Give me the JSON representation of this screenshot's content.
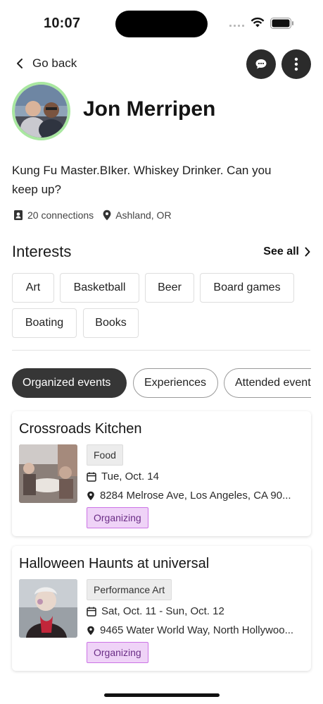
{
  "status_bar": {
    "time": "10:07"
  },
  "header": {
    "back_label": "Go back",
    "chat_icon": "chat-bubble-icon",
    "more_icon": "more-vertical-icon"
  },
  "profile": {
    "name": "Jon Merripen",
    "bio": "Kung Fu Master.BIker. Whiskey Drinker. Can you keep up?",
    "connections": "20 connections",
    "location": "Ashland, OR",
    "avatar_ring_color": "#a9e7a0"
  },
  "interests": {
    "title": "Interests",
    "see_all": "See all",
    "items": [
      "Art",
      "Basketball",
      "Beer",
      "Board games",
      "Boating",
      "Books"
    ]
  },
  "tabs": [
    {
      "label": "Organized events",
      "active": true
    },
    {
      "label": "Experiences",
      "active": false
    },
    {
      "label": "Attended events",
      "active": false
    }
  ],
  "events": [
    {
      "title": "Crossroads Kitchen",
      "category": "Food",
      "date": "Tue, Oct. 14",
      "address": "8284 Melrose Ave, Los Angeles, CA 90...",
      "status": "Organizing"
    },
    {
      "title": "Halloween Haunts at universal",
      "category": "Performance Art",
      "date": "Sat, Oct. 11 - Sun, Oct. 12",
      "address": "9465 Water World Way, North Hollywoo...",
      "status": "Organizing"
    }
  ],
  "colors": {
    "active_tab": "#363636",
    "organizing_bg": "#efd3f7",
    "organizing_border": "#cc73e6"
  }
}
